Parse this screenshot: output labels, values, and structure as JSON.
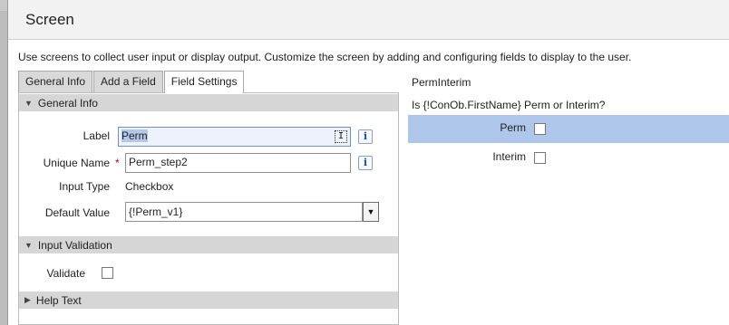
{
  "dialog": {
    "title": "Screen",
    "description": "Use screens to collect user input or display output. Customize the screen by adding and configuring fields to display to the user."
  },
  "tabs": [
    {
      "label": "General Info",
      "active": false
    },
    {
      "label": "Add a Field",
      "active": false
    },
    {
      "label": "Field Settings",
      "active": true
    }
  ],
  "general_info": {
    "header": "General Info",
    "label_label": "Label",
    "label_value": "Perm",
    "unique_name_label": "Unique Name",
    "unique_name_value": "Perm_step2",
    "input_type_label": "Input Type",
    "input_type_value": "Checkbox",
    "default_value_label": "Default Value",
    "default_value_value": "{!Perm_v1}",
    "info_icon_glyph": "i",
    "required_marker": "*"
  },
  "input_validation": {
    "header": "Input Validation",
    "validate_label": "Validate",
    "validate_checked": false
  },
  "help_text": {
    "header": "Help Text"
  },
  "preview": {
    "screen_name": "PermInterim",
    "question": "Is {!ConOb.FirstName} Perm or Interim?",
    "fields": [
      {
        "label": "Perm",
        "checked": false,
        "highlighted": true
      },
      {
        "label": "Interim",
        "checked": false,
        "highlighted": false
      }
    ]
  },
  "colors": {
    "highlight": "#aec6ea",
    "section_header_bg": "#d6d6d6",
    "required": "#cc0000",
    "info_icon": "#1c4fa3"
  },
  "icons": {
    "section_expanded": "triangle-down-icon",
    "section_collapsed": "triangle-right-icon",
    "dropdown": "chevron-down-icon",
    "info": "info-icon"
  }
}
